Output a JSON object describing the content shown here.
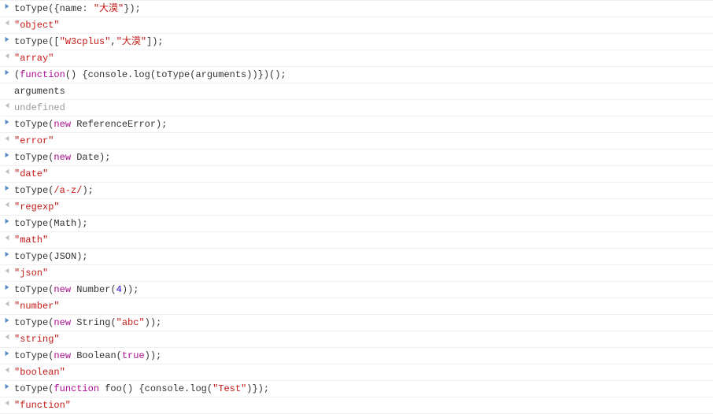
{
  "rows": [
    {
      "dir": "in",
      "tokens": [
        {
          "t": "toType({name: ",
          "c": "d"
        },
        {
          "t": "\"大漠\"",
          "c": "s"
        },
        {
          "t": "});",
          "c": "d"
        }
      ]
    },
    {
      "dir": "out",
      "tokens": [
        {
          "t": "\"object\"",
          "c": "s"
        }
      ]
    },
    {
      "dir": "in",
      "tokens": [
        {
          "t": "toType([",
          "c": "d"
        },
        {
          "t": "\"W3cplus\"",
          "c": "s"
        },
        {
          "t": ",",
          "c": "d"
        },
        {
          "t": "\"大漠\"",
          "c": "s"
        },
        {
          "t": "]);",
          "c": "d"
        }
      ]
    },
    {
      "dir": "out",
      "tokens": [
        {
          "t": "\"array\"",
          "c": "s"
        }
      ]
    },
    {
      "dir": "in",
      "tokens": [
        {
          "t": "(",
          "c": "d"
        },
        {
          "t": "function",
          "c": "k"
        },
        {
          "t": "() {console.log(toType(arguments))})();",
          "c": "d"
        }
      ]
    },
    {
      "dir": "log",
      "tokens": [
        {
          "t": "arguments",
          "c": "d"
        }
      ]
    },
    {
      "dir": "out",
      "tokens": [
        {
          "t": "undefined",
          "c": "u"
        }
      ]
    },
    {
      "dir": "in",
      "tokens": [
        {
          "t": "toType(",
          "c": "d"
        },
        {
          "t": "new",
          "c": "k"
        },
        {
          "t": " ReferenceError);",
          "c": "d"
        }
      ]
    },
    {
      "dir": "out",
      "tokens": [
        {
          "t": "\"error\"",
          "c": "s"
        }
      ]
    },
    {
      "dir": "in",
      "tokens": [
        {
          "t": "toType(",
          "c": "d"
        },
        {
          "t": "new",
          "c": "k"
        },
        {
          "t": " Date);",
          "c": "d"
        }
      ]
    },
    {
      "dir": "out",
      "tokens": [
        {
          "t": "\"date\"",
          "c": "s"
        }
      ]
    },
    {
      "dir": "in",
      "tokens": [
        {
          "t": "toType(",
          "c": "d"
        },
        {
          "t": "/a-z/",
          "c": "r"
        },
        {
          "t": ");",
          "c": "d"
        }
      ]
    },
    {
      "dir": "out",
      "tokens": [
        {
          "t": "\"regexp\"",
          "c": "s"
        }
      ]
    },
    {
      "dir": "in",
      "tokens": [
        {
          "t": "toType(Math);",
          "c": "d"
        }
      ]
    },
    {
      "dir": "out",
      "tokens": [
        {
          "t": "\"math\"",
          "c": "s"
        }
      ]
    },
    {
      "dir": "in",
      "tokens": [
        {
          "t": "toType(JSON);",
          "c": "d"
        }
      ]
    },
    {
      "dir": "out",
      "tokens": [
        {
          "t": "\"json\"",
          "c": "s"
        }
      ]
    },
    {
      "dir": "in",
      "tokens": [
        {
          "t": "toType(",
          "c": "d"
        },
        {
          "t": "new",
          "c": "k"
        },
        {
          "t": " Number(",
          "c": "d"
        },
        {
          "t": "4",
          "c": "n"
        },
        {
          "t": "));",
          "c": "d"
        }
      ]
    },
    {
      "dir": "out",
      "tokens": [
        {
          "t": "\"number\"",
          "c": "s"
        }
      ]
    },
    {
      "dir": "in",
      "tokens": [
        {
          "t": "toType(",
          "c": "d"
        },
        {
          "t": "new",
          "c": "k"
        },
        {
          "t": " String(",
          "c": "d"
        },
        {
          "t": "\"abc\"",
          "c": "s"
        },
        {
          "t": "));",
          "c": "d"
        }
      ]
    },
    {
      "dir": "out",
      "tokens": [
        {
          "t": "\"string\"",
          "c": "s"
        }
      ]
    },
    {
      "dir": "in",
      "tokens": [
        {
          "t": "toType(",
          "c": "d"
        },
        {
          "t": "new",
          "c": "k"
        },
        {
          "t": " Boolean(",
          "c": "d"
        },
        {
          "t": "true",
          "c": "k"
        },
        {
          "t": "));",
          "c": "d"
        }
      ]
    },
    {
      "dir": "out",
      "tokens": [
        {
          "t": "\"boolean\"",
          "c": "s"
        }
      ]
    },
    {
      "dir": "in",
      "tokens": [
        {
          "t": "toType(",
          "c": "d"
        },
        {
          "t": "function",
          "c": "k"
        },
        {
          "t": " foo() {console.log(",
          "c": "d"
        },
        {
          "t": "\"Test\"",
          "c": "s"
        },
        {
          "t": ")});",
          "c": "d"
        }
      ]
    },
    {
      "dir": "out",
      "tokens": [
        {
          "t": "\"function\"",
          "c": "s"
        }
      ]
    }
  ]
}
